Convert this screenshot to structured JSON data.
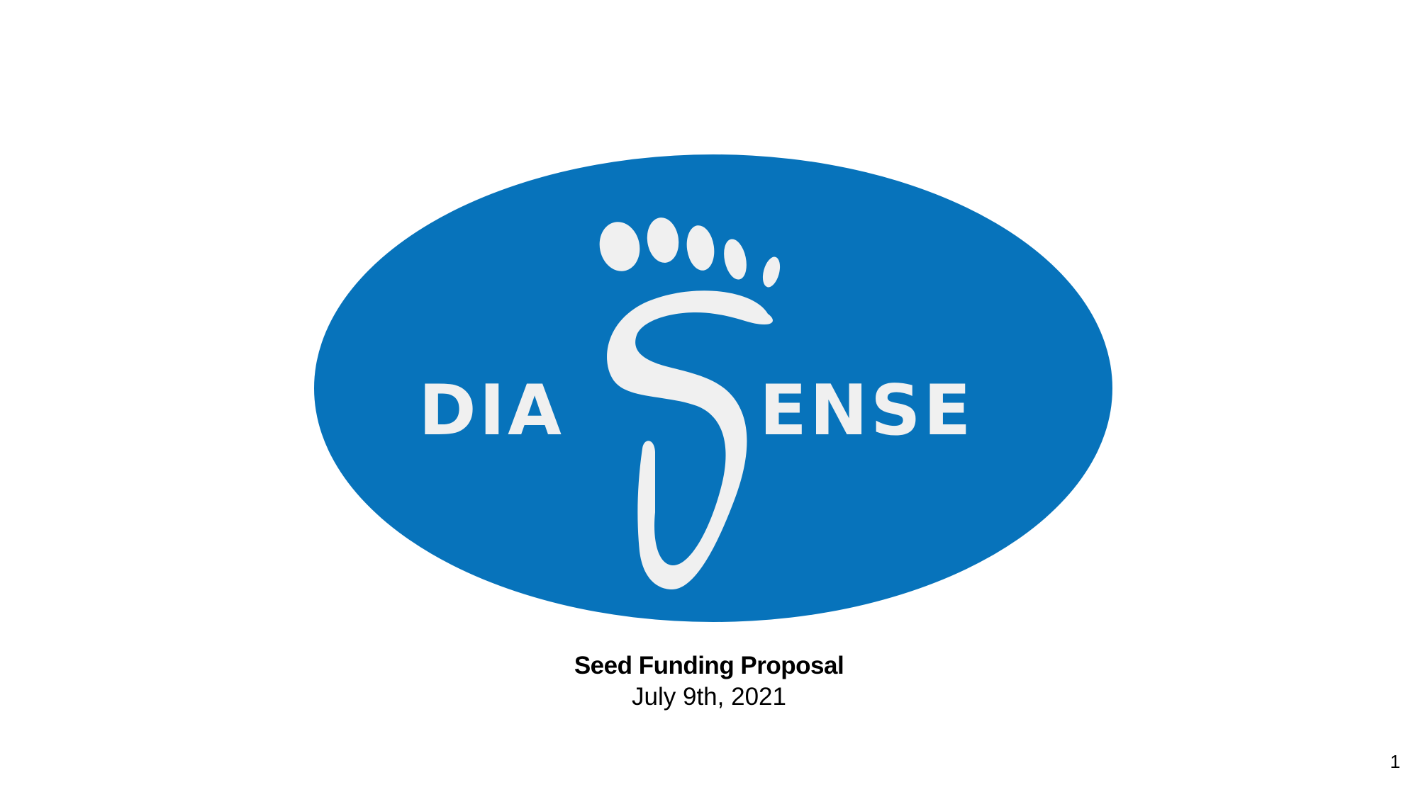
{
  "slide": {
    "logo": {
      "text_left": "DIA",
      "text_right": "ENSE",
      "oval_color": "#0773BB",
      "mark_color": "#F0F0F0",
      "icon": "footprint-s-icon"
    },
    "title": "Seed Funding Proposal",
    "date": "July 9th, 2021",
    "page_number": "1"
  }
}
